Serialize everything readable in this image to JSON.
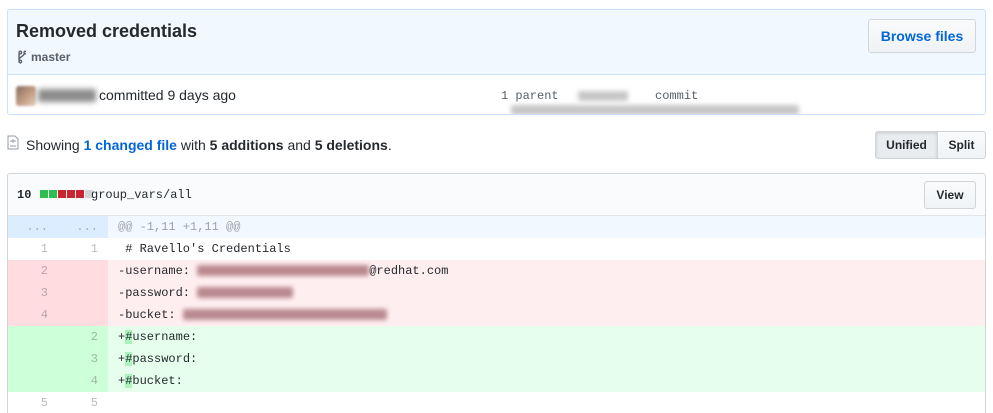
{
  "commit": {
    "title": "Removed credentials",
    "branch": "master",
    "browse_label": "Browse files",
    "committed_text": "committed 9 days ago",
    "parent_label": "1 parent",
    "commit_label": "commit"
  },
  "toc": {
    "showing": "Showing",
    "changed_link": "1 changed file",
    "with": "with",
    "additions": "5 additions",
    "and": "and",
    "deletions": "5 deletions",
    "period": ".",
    "unified_label": "Unified",
    "split_label": "Split"
  },
  "file": {
    "diffstat": "10",
    "diffstat_blocks": [
      "add",
      "add",
      "del",
      "del",
      "del",
      "neu"
    ],
    "name": "group_vars/all",
    "view_label": "View"
  },
  "diff": {
    "hunk_left": "...",
    "hunk_right": "...",
    "hunk_header": "@@ -1,11 +1,11 @@",
    "lines": [
      {
        "type": "ctx",
        "old": "1",
        "new": "1",
        "text": " # Ravello's Credentials"
      },
      {
        "type": "del",
        "old": "2",
        "new": "",
        "prefix": "-username: ",
        "suffix": "@redhat.com"
      },
      {
        "type": "del",
        "old": "3",
        "new": "",
        "prefix": "-password: ",
        "suffix": ""
      },
      {
        "type": "del",
        "old": "4",
        "new": "",
        "prefix": "-bucket: ",
        "suffix": ""
      },
      {
        "type": "add",
        "old": "",
        "new": "2",
        "prefix": "+",
        "hl": "#",
        "suffix": "username:"
      },
      {
        "type": "add",
        "old": "",
        "new": "3",
        "prefix": "+",
        "hl": "#",
        "suffix": "password:"
      },
      {
        "type": "add",
        "old": "",
        "new": "4",
        "prefix": "+",
        "hl": "#",
        "suffix": "bucket:"
      },
      {
        "type": "ctx",
        "old": "5",
        "new": "5",
        "text": ""
      }
    ]
  },
  "colors": {
    "accent": "#0366d6",
    "addition": "#2cbe4e",
    "deletion": "#cb2431"
  }
}
